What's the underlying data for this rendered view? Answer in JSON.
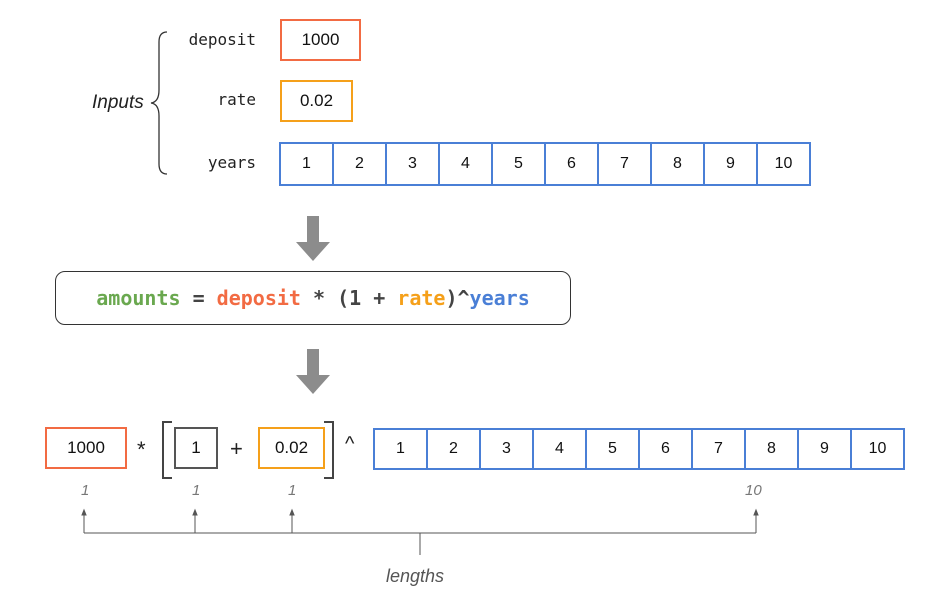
{
  "colors": {
    "deposit": "#f26b43",
    "rate": "#f5a01a",
    "years": "#4a7fd6",
    "amounts": "#6aa84f",
    "neutral": "#444444",
    "arrow": "#8c8c8c"
  },
  "inputs": {
    "group_label": "Inputs",
    "deposit": {
      "label": "deposit",
      "value": "1000"
    },
    "rate": {
      "label": "rate",
      "value": "0.02"
    },
    "years": {
      "label": "years",
      "values": [
        "1",
        "2",
        "3",
        "4",
        "5",
        "6",
        "7",
        "8",
        "9",
        "10"
      ]
    }
  },
  "formula": {
    "amounts": "amounts",
    "equals": " = ",
    "deposit": "deposit",
    "times_open": " * (1 + ",
    "rate": "rate",
    "close_pow": ")^",
    "years": "years"
  },
  "expansion": {
    "deposit_value": "1000",
    "multiply": "*",
    "one_value": "1",
    "plus": "+",
    "rate_value": "0.02",
    "power": "^",
    "years_values": [
      "1",
      "2",
      "3",
      "4",
      "5",
      "6",
      "7",
      "8",
      "9",
      "10"
    ]
  },
  "lengths": {
    "deposit": "1",
    "one": "1",
    "rate": "1",
    "years": "10",
    "label": "lengths"
  }
}
